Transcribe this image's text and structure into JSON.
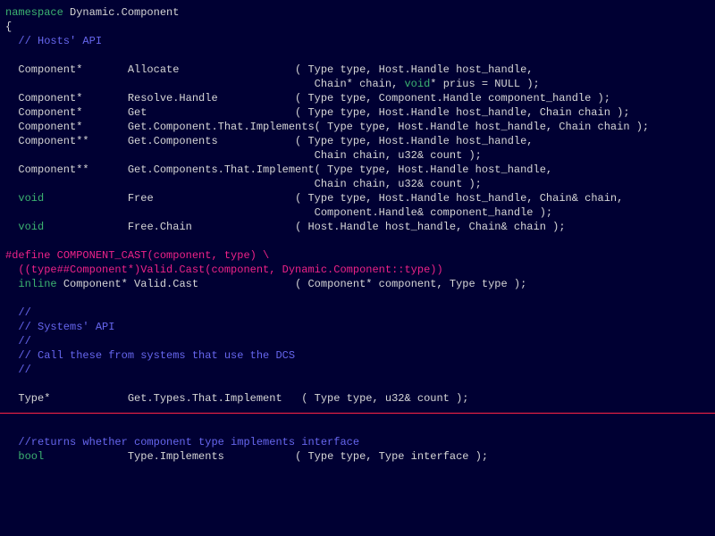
{
  "l1_kw": "namespace",
  "l1_rest": " Dynamic.Component",
  "l2": "{",
  "l3_cm": "  // Hosts' API",
  "blank": "",
  "l5": "  Component*       Allocate                  ( Type type, Host.Handle host_handle,",
  "l6a": "                                                Chain* chain, ",
  "l6_kw": "void",
  "l6b": "* prius = NULL );",
  "l7": "  Component*       Resolve.Handle            ( Type type, Component.Handle component_handle );",
  "l8": "  Component*       Get                       ( Type type, Host.Handle host_handle, Chain chain );",
  "l9": "  Component*       Get.Component.That.Implements( Type type, Host.Handle host_handle, Chain chain );",
  "l10": "  Component**      Get.Components            ( Type type, Host.Handle host_handle,",
  "l11": "                                                Chain chain, u32& count );",
  "l12": "  Component**      Get.Components.That.Implement( Type type, Host.Handle host_handle,",
  "l13": "                                                Chain chain, u32& count );",
  "l14_pad": "  ",
  "l14_kw": "void",
  "l14_rest": "             Free                      ( Type type, Host.Handle host_handle, Chain& chain,",
  "l15": "                                                Component.Handle& component_handle );",
  "l16_pad": "  ",
  "l16_kw": "void",
  "l16_rest": "             Free.Chain                ( Host.Handle host_handle, Chain& chain );",
  "m1_kw": "#define",
  "m1_rest": " COMPONENT_CAST(component, type) \\",
  "m2": "  ((type##Component*)Valid.Cast(component, Dynamic.Component::type))",
  "m3_pad": "  ",
  "m3_kw": "inline",
  "m3_rest": " Component* Valid.Cast               ( Component* component, Type type );",
  "s1": "  //",
  "s2": "  // Systems' API",
  "s3": "  //",
  "s4": "  // Call these from systems that use the DCS",
  "s5": "  //",
  "t1": "  Type*            Get.Types.That.Implement   ( Type type, u32& count );",
  "r1_cm": "  //returns whether component type implements interface",
  "r2_pad": "  ",
  "r2_kw": "bool",
  "r2_rest": "             Type.Implements           ( Type type, Type interface );"
}
